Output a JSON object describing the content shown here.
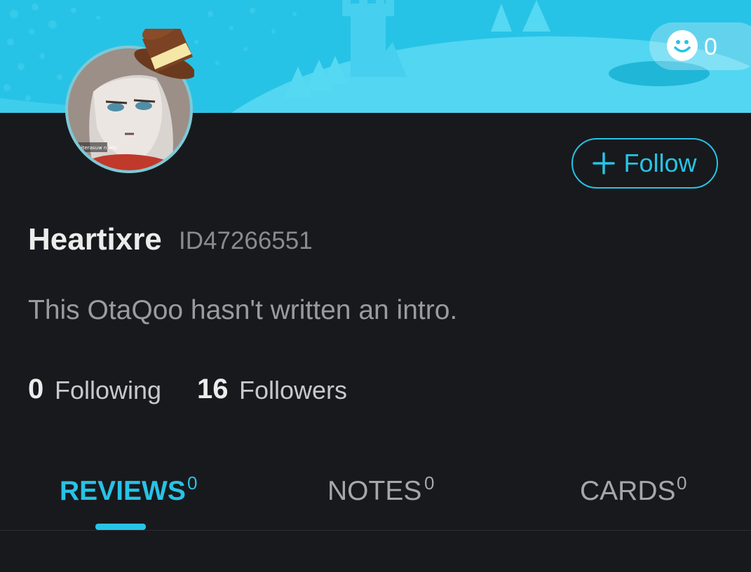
{
  "header": {
    "reaction_count": "0",
    "reaction_icon": "smile-icon",
    "accent_color": "#27c3e6"
  },
  "profile": {
    "name": "Heartixre",
    "id_label": "ID47266551",
    "intro": "This OtaQoo hasn't written an intro.",
    "follow_label": "Follow",
    "follow_icon": "plus-icon",
    "avatar_caption": "naiterasuw n whi"
  },
  "stats": {
    "following_count": "0",
    "following_label": "Following",
    "followers_count": "16",
    "followers_label": "Followers"
  },
  "tabs": [
    {
      "label": "REVIEWS",
      "count": "0",
      "active": true
    },
    {
      "label": "NOTES",
      "count": "0",
      "active": false
    },
    {
      "label": "CARDS",
      "count": "0",
      "active": false
    }
  ]
}
